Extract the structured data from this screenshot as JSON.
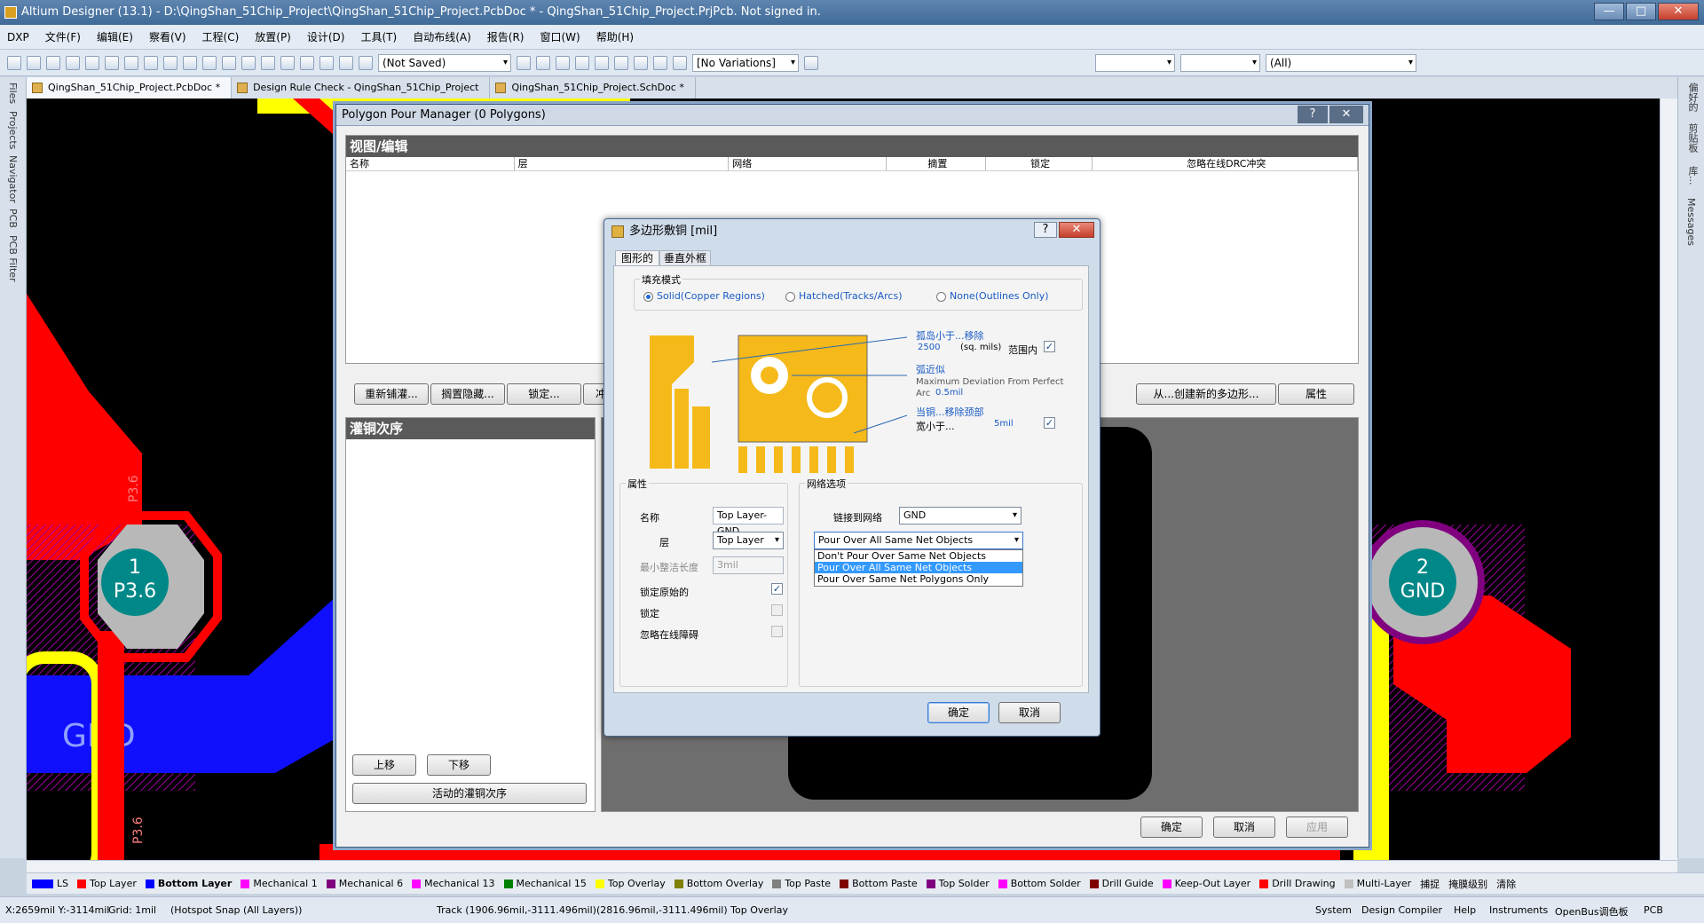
{
  "window": {
    "title": "Altium Designer (13.1) - D:\\QingShan_51Chip_Project\\QingShan_51Chip_Project.PcbDoc * - QingShan_51Chip_Project.PrjPcb. Not signed in.",
    "min": "—",
    "max": "□",
    "close": "✕"
  },
  "menu": [
    "DXP",
    "文件(F)",
    "编辑(E)",
    "察看(V)",
    "工程(C)",
    "放置(P)",
    "设计(D)",
    "工具(T)",
    "自动布线(A)",
    "报告(R)",
    "窗口(W)",
    "帮助(H)"
  ],
  "toolbar": {
    "not_saved": "(Not Saved)",
    "variations": "[No Variations]",
    "all": "(All)"
  },
  "tabs": [
    {
      "label": "QingShan_51Chip_Project.PcbDoc *"
    },
    {
      "label": "Design Rule Check - QingShan_51Chip_Project"
    },
    {
      "label": "QingShan_51Chip_Project.SchDoc *"
    }
  ],
  "left_panels": [
    "Files",
    "Projects",
    "Navigator",
    "PCB",
    "PCB Filter"
  ],
  "right_panels": [
    "偏好的",
    "剪贴板",
    "库...",
    "Messages"
  ],
  "pcb": {
    "pad1_num": "1",
    "pad1_net": "P3.6",
    "pad2_num": "2",
    "pad2_net": "GND",
    "track_label": "P3.6",
    "gnd_label": "GND",
    "bottom_label": "P3.6"
  },
  "ppm": {
    "title": "Polygon Pour Manager (0 Polygons)",
    "help": "?",
    "close": "✕",
    "view_edit": "视图/编辑",
    "columns": [
      "名称",
      "层",
      "网络",
      "摘置",
      "锁定",
      "忽略在线DRC冲突"
    ],
    "buttons": {
      "repour": "重新铺灌...",
      "shelve": "搁置隐藏...",
      "lock": "锁定...",
      "fourth": "冲",
      "create_from": "从...创建新的多边形...",
      "properties": "属性"
    },
    "pour_order": "灌铜次序",
    "up": "上移",
    "down": "下移",
    "active_order": "活动的灌铜次序",
    "ok": "确定",
    "cancel": "取消",
    "apply": "应用"
  },
  "dialog": {
    "title": "多边形敷铜 [mil]",
    "help": "?",
    "close": "✕",
    "tab_graphic": "图形的",
    "tab_outline": "垂直外框",
    "fill_mode": "填充模式",
    "fill_options": [
      "Solid(Copper Regions)",
      "Hatched(Tracks/Arcs)",
      "None(Outlines Only)"
    ],
    "island_label": "孤岛小于...移除",
    "island_value": "2500",
    "island_unit": "(sq. mils)",
    "island_range": "范围内",
    "arc_label": "弧近似",
    "arc_desc": "Maximum Deviation From Perfect Arc",
    "arc_value": "0.5mil",
    "neck_label1": "当铜...移除颈部",
    "neck_label2": "宽小于...",
    "neck_value": "5mil",
    "props_title": "属性",
    "name_label": "名称",
    "name_value": "Top Layer-GND",
    "layer_label": "层",
    "layer_value": "Top Layer",
    "min_len_label": "最小整洁长度",
    "min_len_value": "3mil",
    "lock_prim_label": "锁定原始的",
    "lock_label": "锁定",
    "ignore_label": "忽略在线障碍",
    "net_title": "网络选项",
    "connect_label": "链接到网络",
    "connect_value": "GND",
    "pour_value": "Pour Over All Same Net Objects",
    "pour_options": [
      "Don't Pour Over Same Net Objects",
      "Pour Over All Same Net Objects",
      "Pour Over Same Net Polygons Only"
    ],
    "ok": "确定",
    "cancel": "取消",
    "check": "✓"
  },
  "layers": [
    {
      "name": "LS",
      "color": "#0000ff"
    },
    {
      "name": "Top Layer",
      "color": "#ff0000"
    },
    {
      "name": "Bottom Layer",
      "color": "#0000ff"
    },
    {
      "name": "Mechanical 1",
      "color": "#ff00ff"
    },
    {
      "name": "Mechanical 6",
      "color": "#800080"
    },
    {
      "name": "Mechanical 13",
      "color": "#ff00ff"
    },
    {
      "name": "Mechanical 15",
      "color": "#008000"
    },
    {
      "name": "Top Overlay",
      "color": "#ffff00"
    },
    {
      "name": "Bottom Overlay",
      "color": "#808000"
    },
    {
      "name": "Top Paste",
      "color": "#808080"
    },
    {
      "name": "Bottom Paste",
      "color": "#800000"
    },
    {
      "name": "Top Solder",
      "color": "#800080"
    },
    {
      "name": "Bottom Solder",
      "color": "#ff00ff"
    },
    {
      "name": "Drill Guide",
      "color": "#800000"
    },
    {
      "name": "Keep-Out Layer",
      "color": "#ff00ff"
    },
    {
      "name": "Drill Drawing",
      "color": "#ff0000"
    },
    {
      "name": "Multi-Layer",
      "color": "#c0c0c0"
    }
  ],
  "layer_right": {
    "snap": "捕捉",
    "mask": "掩膜级别",
    "clear": "清除"
  },
  "status": {
    "coords": "X:2659mil Y:-3114mil",
    "grid": "Grid: 1mil",
    "snap": "(Hotspot Snap (All Layers))",
    "track": "Track (1906.96mil,-3111.496mil)(2816.96mil,-3111.496mil)  Top Overlay",
    "panels": [
      "System",
      "Design Compiler",
      "Help",
      "Instruments",
      "OpenBus调色板",
      "PCB"
    ]
  }
}
